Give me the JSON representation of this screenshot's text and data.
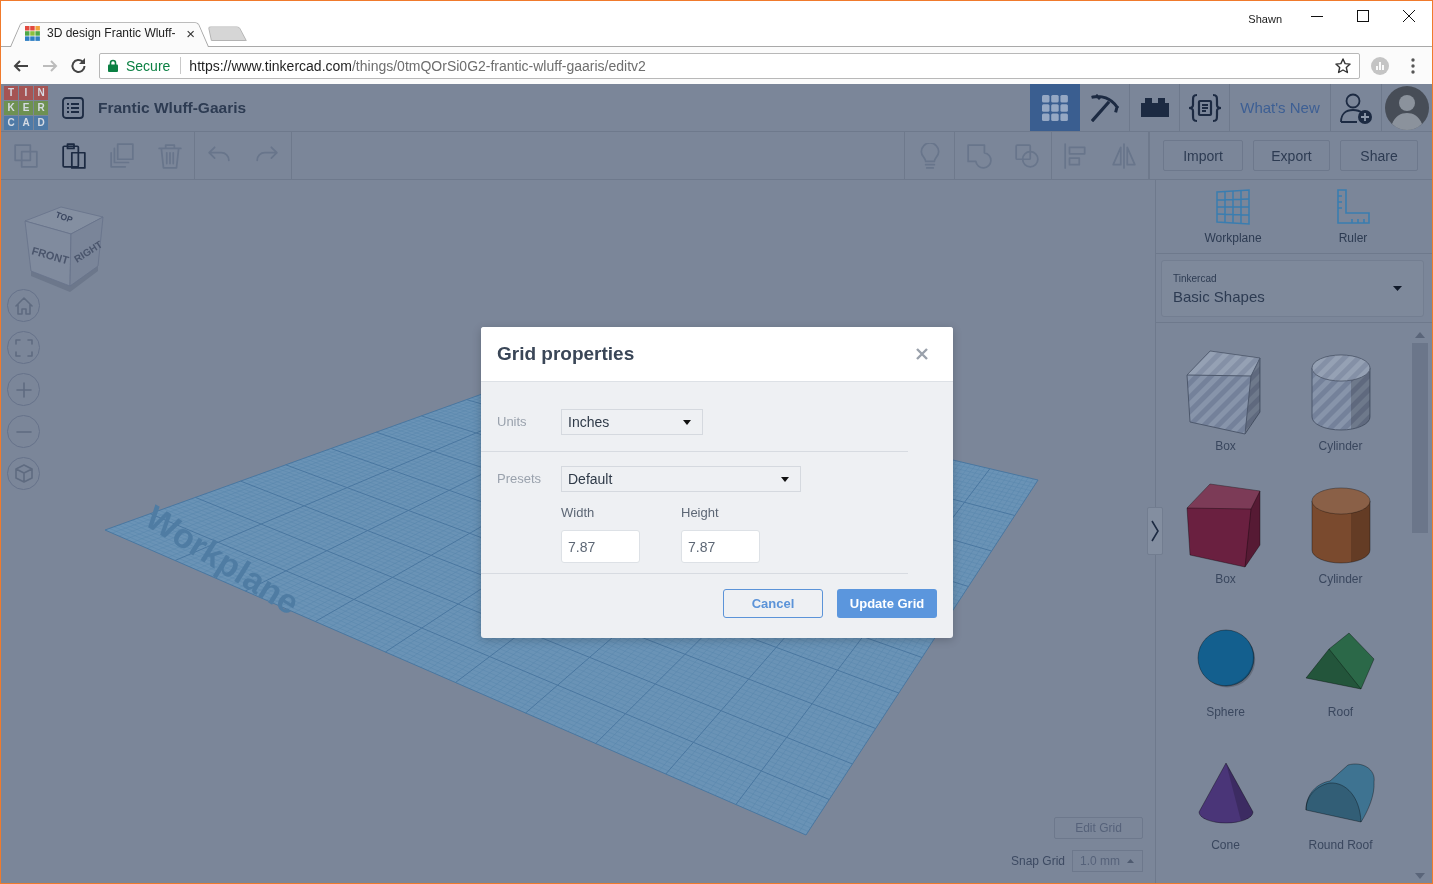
{
  "browser": {
    "tab": {
      "title": "3D design Frantic Wluff-",
      "close": "×"
    },
    "profile": "Shawn",
    "nav_buttons": [
      {
        "disabled": false
      },
      {
        "disabled": true
      },
      {
        "disabled": false
      }
    ],
    "address": {
      "security": "Secure",
      "origin": "https://www.tinkercad.com",
      "path": "/things/0tmQOrSi0G2-frantic-wluff-gaaris/editv2"
    }
  },
  "app": {
    "logo": [
      [
        "T",
        "I",
        "N"
      ],
      [
        "K",
        "E",
        "R"
      ],
      [
        "C",
        "A",
        "D"
      ]
    ],
    "design_title": "Frantic Wluff-Gaaris",
    "view_tabs": [
      {
        "selected": true
      },
      {
        "selected": false
      },
      {
        "selected": false
      },
      {
        "selected": false
      }
    ],
    "whats_new": "What's New"
  },
  "toolbar": {
    "edit_tools": [
      {
        "disabled": true
      },
      {
        "disabled": false
      },
      {
        "disabled": true
      },
      {
        "disabled": true
      }
    ],
    "history_tools": [
      {
        "disabled": true
      },
      {
        "disabled": true
      }
    ],
    "shape_tools": [
      {
        "disabled": true
      },
      {
        "disabled": true
      },
      {
        "disabled": true
      },
      {
        "disabled": true
      },
      {
        "disabled": true
      }
    ],
    "buttons": [
      "Import",
      "Export",
      "Share"
    ]
  },
  "viewport": {
    "view_cube": {
      "top": "TOP",
      "front": "FRONT",
      "right": "RIGHT"
    },
    "workplane_label": "Workplane",
    "edit_grid": "Edit Grid",
    "snap_grid": {
      "label": "Snap Grid",
      "value": "1.0 mm"
    }
  },
  "panel": {
    "tools": [
      {
        "label": "Workplane"
      },
      {
        "label": "Ruler"
      }
    ],
    "library": {
      "source": "Tinkercad",
      "category": "Basic Shapes"
    },
    "shapes": [
      {
        "name": "Box",
        "kind": "box",
        "hole": true
      },
      {
        "name": "Cylinder",
        "kind": "cylinder",
        "hole": true
      },
      {
        "name": "Box",
        "kind": "box",
        "hole": false,
        "color": "#6a2040"
      },
      {
        "name": "Cylinder",
        "kind": "cylinder",
        "hole": false,
        "color": "#7a4a2e"
      },
      {
        "name": "Sphere",
        "kind": "sphere",
        "hole": false,
        "color": "#135f8e"
      },
      {
        "name": "Roof",
        "kind": "roof",
        "hole": false,
        "color": "#2b6848"
      },
      {
        "name": "Cone",
        "kind": "cone",
        "hole": false,
        "color": "#4a3578"
      },
      {
        "name": "Round Roof",
        "kind": "roundroof",
        "hole": false,
        "color": "#3e7391"
      }
    ]
  },
  "dialog": {
    "title": "Grid properties",
    "units": {
      "label": "Units",
      "value": "Inches"
    },
    "presets": {
      "label": "Presets",
      "value": "Default"
    },
    "width": {
      "label": "Width",
      "value": "7.87"
    },
    "height": {
      "label": "Height",
      "value": "7.87"
    },
    "buttons": [
      {
        "label": "Cancel",
        "kind": "secondary"
      },
      {
        "label": "Update Grid",
        "kind": "primary"
      }
    ]
  }
}
